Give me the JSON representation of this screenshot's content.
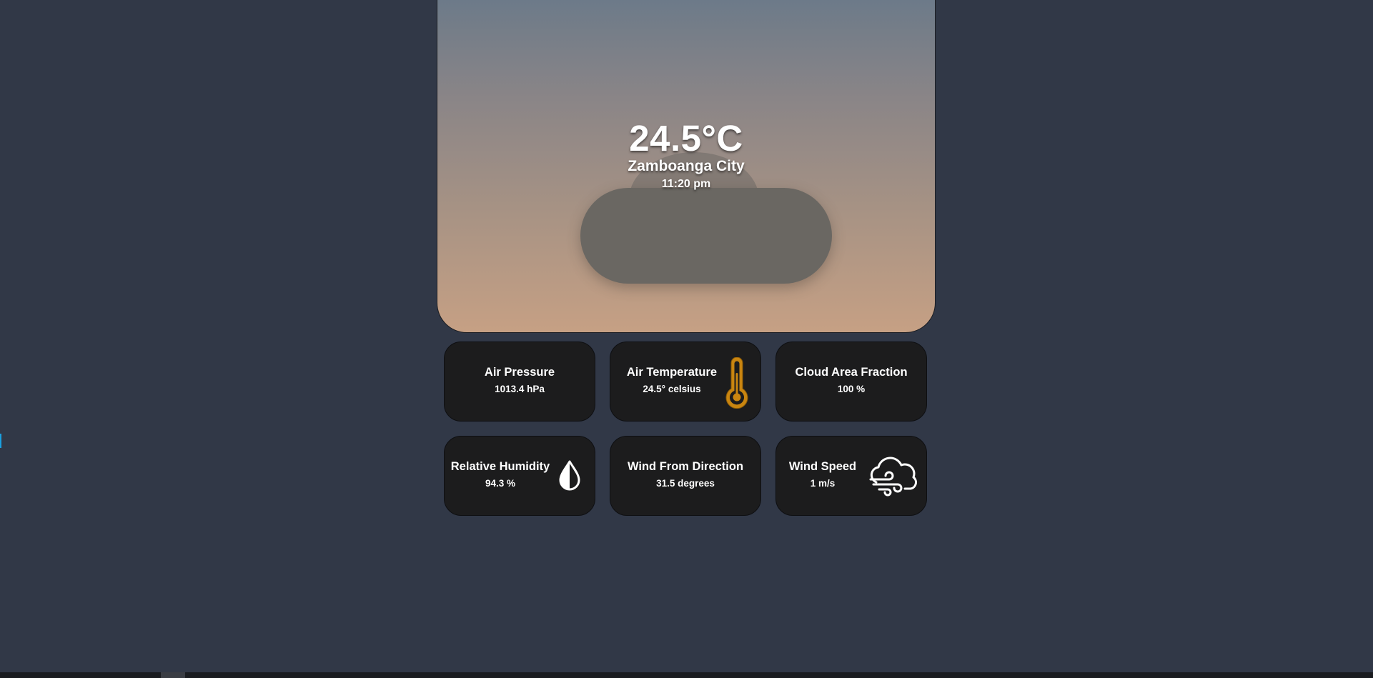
{
  "hero": {
    "temperature": "24.5°C",
    "city": "Zamboanga City",
    "time": "11:20 pm",
    "condition_icon": "cloud-icon"
  },
  "tiles": [
    {
      "label": "Air Pressure",
      "value": "1013.4 hPa",
      "icon": null
    },
    {
      "label": "Air Temperature",
      "value": "24.5° celsius",
      "icon": "thermometer-icon"
    },
    {
      "label": "Cloud Area Fraction",
      "value": "100 %",
      "icon": null
    },
    {
      "label": "Relative Humidity",
      "value": "94.3 %",
      "icon": "water-drop-icon"
    },
    {
      "label": "Wind From Direction",
      "value": "31.5 degrees",
      "icon": null
    },
    {
      "label": "Wind Speed",
      "value": "1 m/s",
      "icon": "wind-cloud-icon"
    }
  ],
  "colors": {
    "page_background": "#313847",
    "tile_background": "#1c1c1d",
    "thermometer_accent": "#c98510",
    "sky_top": "#6c7a89",
    "sky_bottom": "#c6a084"
  }
}
